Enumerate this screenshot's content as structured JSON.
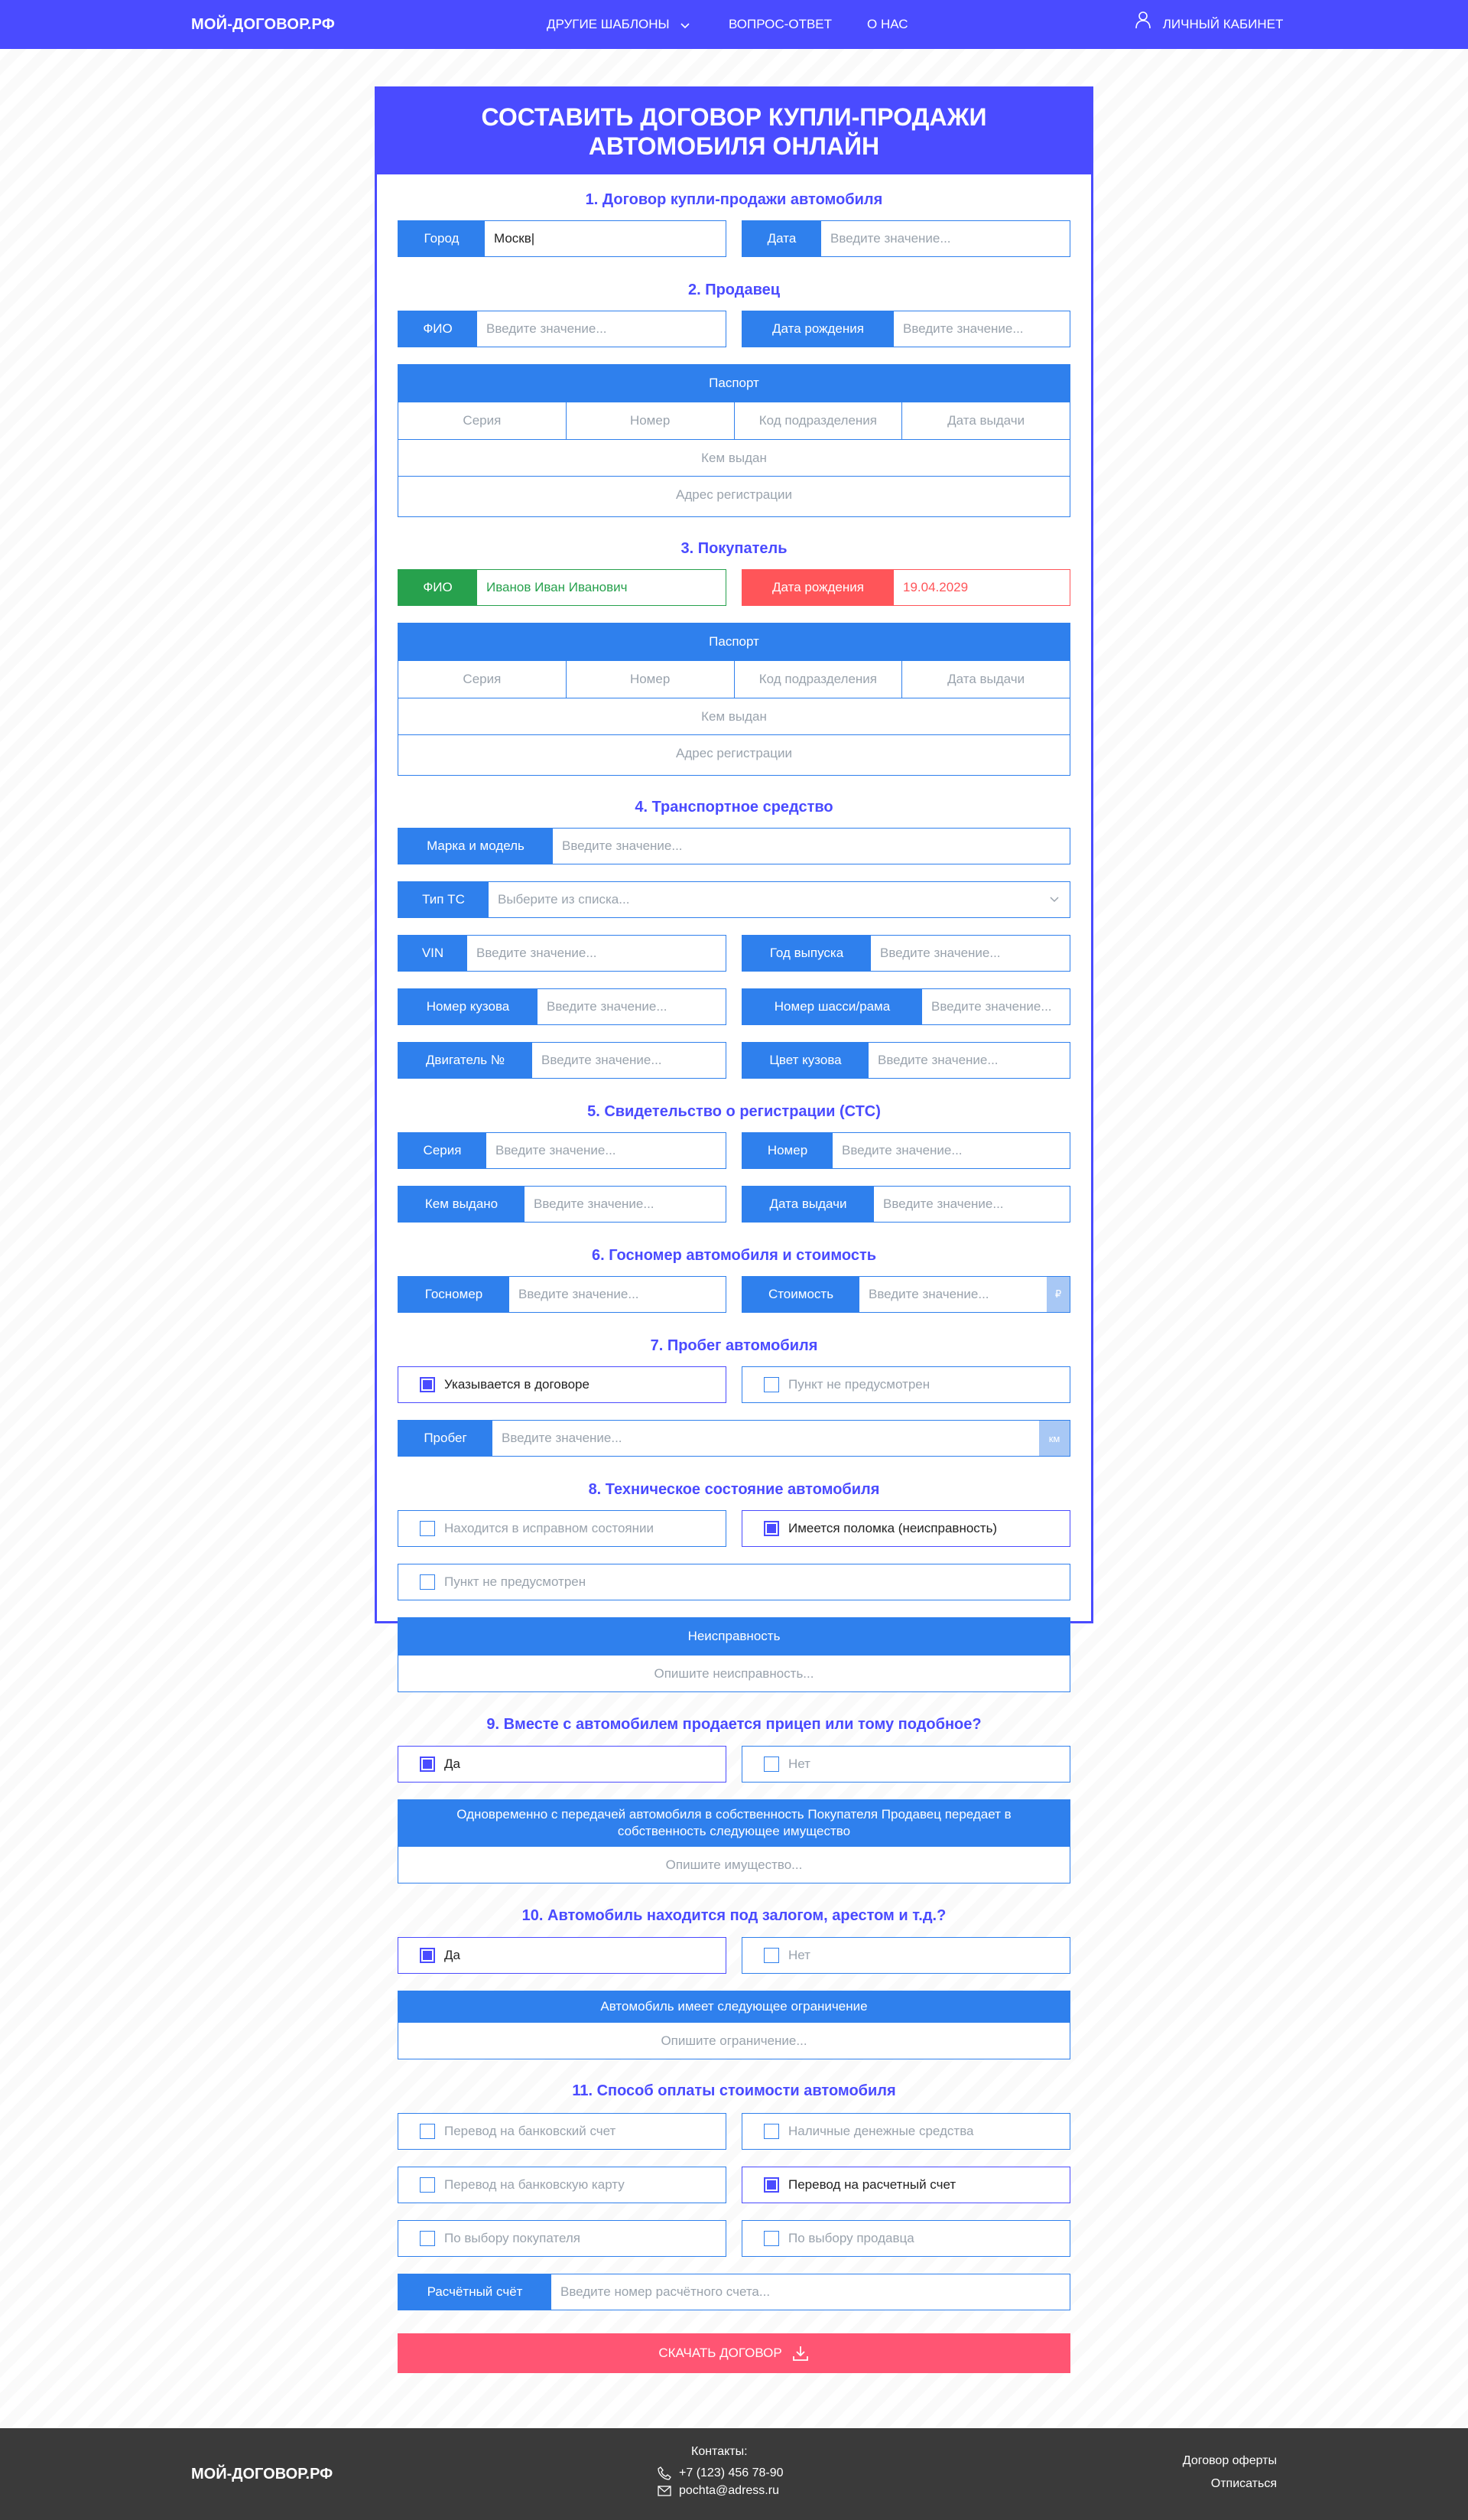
{
  "header": {
    "logo": "МОЙ-ДОГОВОР.РФ",
    "nav": [
      "ДРУГИЕ ШАБЛОНЫ",
      "ВОПРОС-ОТВЕТ",
      "О НАС"
    ],
    "cabinet": "ЛИЧНЫЙ КАБИНЕТ"
  },
  "form": {
    "title": "СОСТАВИТЬ ДОГОВОР КУПЛИ-ПРОДАЖИ АВТОМОБИЛЯ ОНЛАЙН",
    "placeholder": "Введите значение...",
    "s1": {
      "title": "1. Договор купли-продажи автомобиля",
      "city_label": "Город",
      "city_value": "Москв|",
      "date_label": "Дата"
    },
    "s2": {
      "title": "2. Продавец",
      "fio_label": "ФИО",
      "dob_label": "Дата рождения"
    },
    "passport": {
      "title": "Паспорт",
      "series": "Серия",
      "number": "Номер",
      "code": "Код подразделения",
      "issue_date": "Дата выдачи",
      "issued_by": "Кем выдан",
      "address": "Адрес регистрации"
    },
    "s3": {
      "title": "3. Покупатель",
      "fio_label": "ФИО",
      "fio_value": "Иванов Иван Иванович",
      "dob_label": "Дата рождения",
      "dob_value": "19.04.2029"
    },
    "s4": {
      "title": "4. Транспортное средство",
      "make_label": "Марка и модель",
      "type_label": "Тип ТС",
      "type_placeholder": "Выберите из списка...",
      "vin_label": "VIN",
      "year_label": "Год выпуска",
      "body_label": "Номер кузова",
      "chassis_label": "Номер шасси/рама",
      "engine_label": "Двигатель №",
      "color_label": "Цвет кузова"
    },
    "s5": {
      "title": "5. Свидетельство о регистрации (СТС)",
      "series_label": "Серия",
      "number_label": "Номер",
      "issued_by_label": "Кем выдано",
      "issue_date_label": "Дата выдачи"
    },
    "s6": {
      "title": "6. Госномер автомобиля и стоимость",
      "plate_label": "Госномер",
      "price_label": "Стоимость",
      "price_unit": "₽"
    },
    "s7": {
      "title": "7. Пробег автомобиля",
      "opt_yes": "Указывается в договоре",
      "opt_no": "Пункт не предусмотрен",
      "mileage_label": "Пробег",
      "mileage_unit": "км"
    },
    "s8": {
      "title": "8. Техническое состояние автомобиля",
      "opt_ok": "Находится в исправном состоянии",
      "opt_broken": "Имеется поломка (неисправность)",
      "opt_none": "Пункт не предусмотрен",
      "fault_title": "Неисправность",
      "fault_placeholder": "Опишите неисправность..."
    },
    "s9": {
      "title": "9. Вместе с автомобилем продается прицеп или тому подобное?",
      "yes": "Да",
      "no": "Нет",
      "block_title": "Одновременно с передачей автомобиля в собственность Покупателя Продавец передает в собственность следующее имущество",
      "placeholder": "Опишите имущество..."
    },
    "s10": {
      "title": "10. Автомобиль находится под залогом, арестом и т.д.?",
      "yes": "Да",
      "no": "Нет",
      "block_title": "Автомобиль имеет следующее ограничение",
      "placeholder": "Опишите ограничение..."
    },
    "s11": {
      "title": "11. Способ оплаты стоимости автомобиля",
      "bank_account": "Перевод на банковский счет",
      "cash": "Наличные денежные средства",
      "bank_card": "Перевод на банковскую карту",
      "settlement": "Перевод на расчетный счет",
      "buyer_choice": "По выбору покупателя",
      "seller_choice": "По выбору продавца",
      "account_label": "Расчётный счёт",
      "account_placeholder": "Введите номер расчётного счета..."
    },
    "download": "СКАЧАТЬ ДОГОВОР"
  },
  "footer": {
    "logo": "МОЙ-ДОГОВОР.РФ",
    "contacts_title": "Контакты:",
    "phone": "+7 (123) 456 78-90",
    "email": "pochta@adress.ru",
    "offer": "Договор оферты",
    "unsubscribe": "Отписаться"
  },
  "colors": {
    "primary": "#4a4bff",
    "field": "#2f80ed",
    "valid": "#27a14d",
    "error": "#ff5559",
    "download": "#ff5573",
    "footer": "#3a3a3a"
  }
}
